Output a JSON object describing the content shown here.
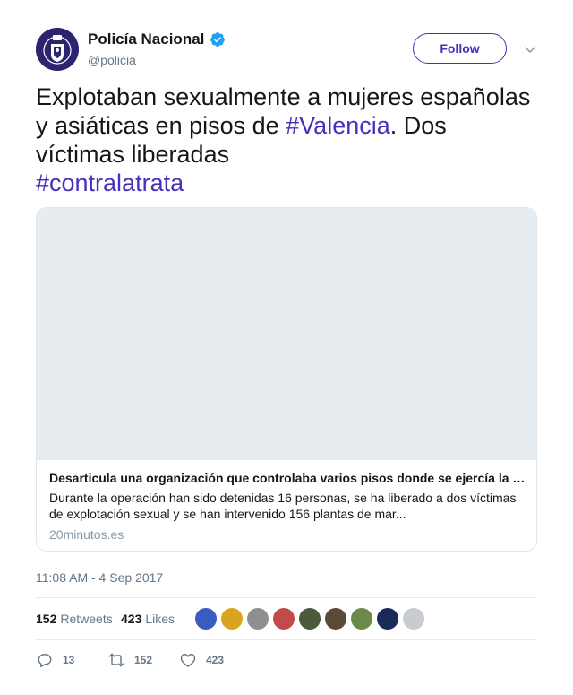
{
  "colors": {
    "accent": "#4a2fbd",
    "verified": "#1da1f2",
    "text_primary": "#14171a",
    "text_secondary": "#657786",
    "border": "#e1e8ed"
  },
  "author": {
    "name": "Policía Nacional",
    "handle": "@policia",
    "verified_icon": "verified-badge-icon",
    "avatar_icon": "police-crest-icon"
  },
  "header": {
    "follow_label": "Follow",
    "more_icon": "chevron-down-icon"
  },
  "tweet": {
    "text_part1": "Explotaban sexualmente a mujeres españolas y asiáticas en pisos de ",
    "hashtag1": "#Valencia",
    "text_part2": ". Dos víctimas liberadas",
    "hashtag2": "#contralatrata",
    "timestamp": "11:08 AM - 4 Sep 2017"
  },
  "card": {
    "title": "Desarticula una organización que controlaba varios pisos donde se ejercía la prostitución",
    "description": "Durante la operación han sido detenidas 16 personas, se ha liberado a dos víctimas de explotación sexual y se han intervenido 156 plantas de mar...",
    "domain": "20minutos.es"
  },
  "stats": {
    "retweets_count": "152",
    "retweets_label": "Retweets",
    "likes_count": "423",
    "likes_label": "Likes"
  },
  "likers": [
    {
      "label": "liker-avatar-1",
      "color": "#3b5bbf"
    },
    {
      "label": "liker-avatar-2",
      "color": "#d9a520"
    },
    {
      "label": "liker-avatar-3",
      "color": "#8f8f8f"
    },
    {
      "label": "liker-avatar-4",
      "color": "#c24a4a"
    },
    {
      "label": "liker-avatar-5",
      "color": "#4a5a3a"
    },
    {
      "label": "liker-avatar-6",
      "color": "#5a4a3a"
    },
    {
      "label": "liker-avatar-7",
      "color": "#6a8a4a"
    },
    {
      "label": "liker-avatar-8",
      "color": "#1a2a5a"
    },
    {
      "label": "liker-avatar-9",
      "color": "#c8ccd0"
    }
  ],
  "actions": {
    "reply_count": "13",
    "retweet_count": "152",
    "like_count": "423",
    "reply_icon": "reply-icon",
    "retweet_icon": "retweet-icon",
    "like_icon": "heart-icon"
  }
}
